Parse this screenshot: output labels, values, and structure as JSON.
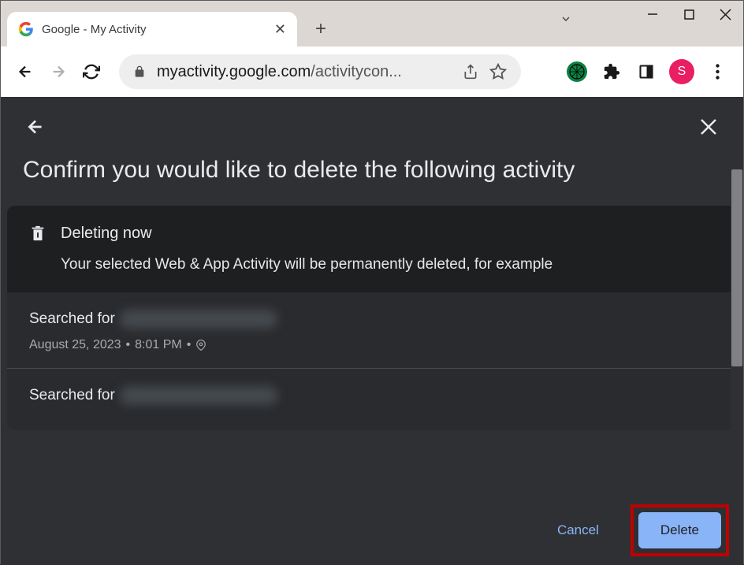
{
  "browser": {
    "tab_title": "Google - My Activity",
    "url_prefix": "myactivity.google.com",
    "url_path": "/activitycon...",
    "avatar_letter": "S"
  },
  "page": {
    "title": "Confirm you would like to delete the following activity"
  },
  "card": {
    "heading": "Deleting now",
    "description": "Your selected Web & App Activity will be permanently deleted, for example"
  },
  "activities": [
    {
      "prefix": "Searched for",
      "date": "August 25, 2023",
      "time": "8:01 PM"
    },
    {
      "prefix": "Searched for"
    }
  ],
  "buttons": {
    "cancel": "Cancel",
    "delete": "Delete"
  }
}
